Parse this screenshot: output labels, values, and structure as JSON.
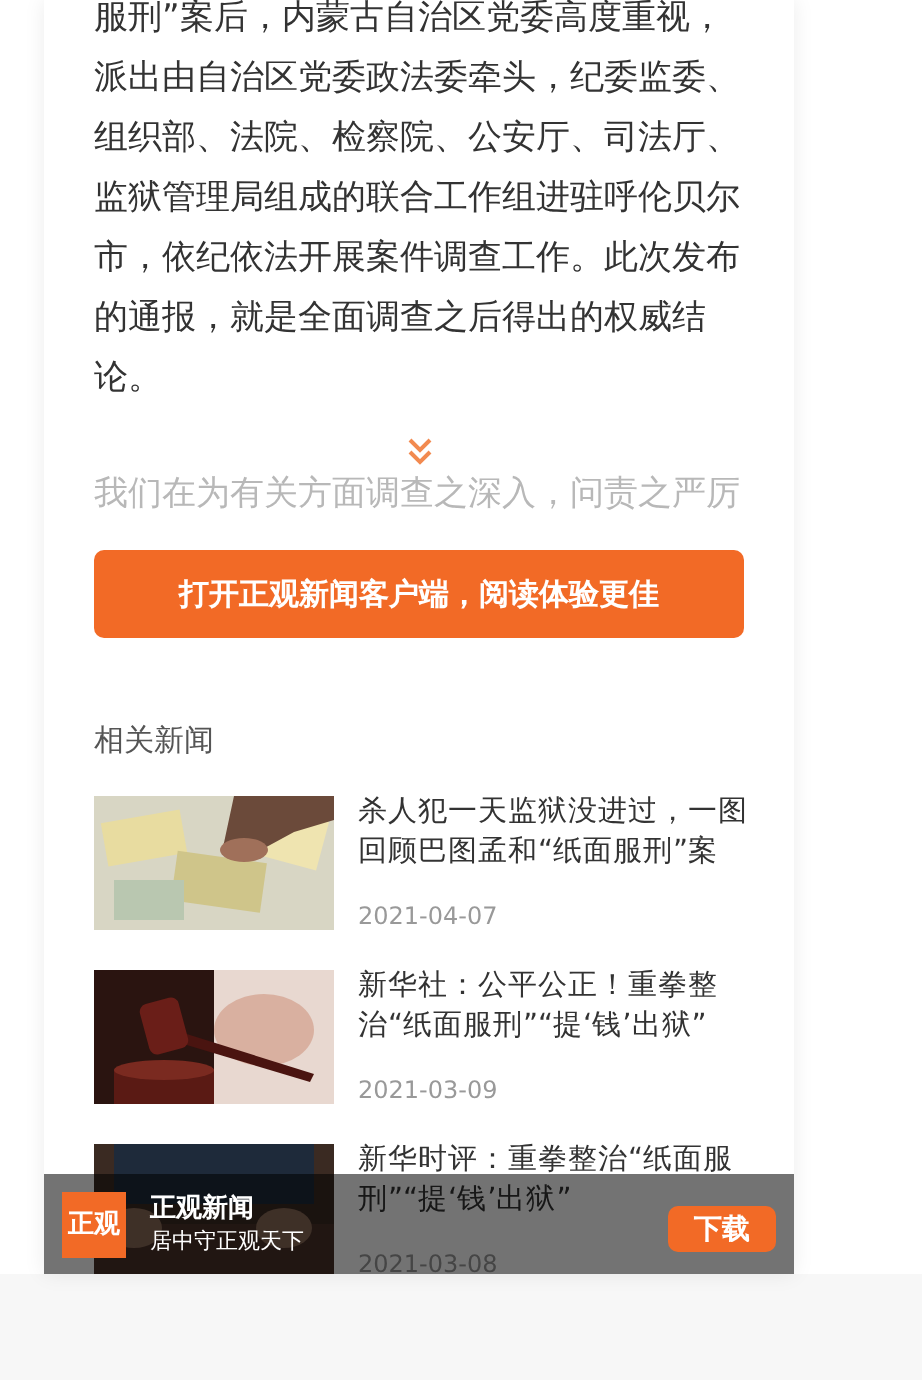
{
  "article": {
    "paragraph": "服刑”案后，内蒙古自治区党委高度重视，派出由自治区党委政法委牵头，纪委监委、组织部、法院、检察院、公安厅、司法厅、监狱管理局组成的联合工作组进驻呼伦贝尔市，依纪依法开展案件调查工作。此次发布的通报，就是全面调查之后得出的权威结论。",
    "faded_text": "我们在为有关方面调查之深入，问责之严厉"
  },
  "open_app_button": "打开正观新闻客户端，阅读体验更佳",
  "related": {
    "heading": "相关新闻",
    "items": [
      {
        "kind": "money",
        "title": "杀人犯一天监狱没进过，一图回顾巴图孟和“纸面服刑”案",
        "date": "2021-04-07"
      },
      {
        "kind": "gavel",
        "title": "新华社：公平公正！重拳整治“纸面服刑”“提‘钱’出狱”",
        "date": "2021-03-09"
      },
      {
        "kind": "hands",
        "title": "新华时评：重拳整治“纸面服刑”“提‘钱’出狱”",
        "date": "2021-03-08"
      }
    ]
  },
  "app_banner": {
    "logo": "正观",
    "name": "正观新闻",
    "slogan": "居中守正观天下",
    "download": "下载"
  }
}
